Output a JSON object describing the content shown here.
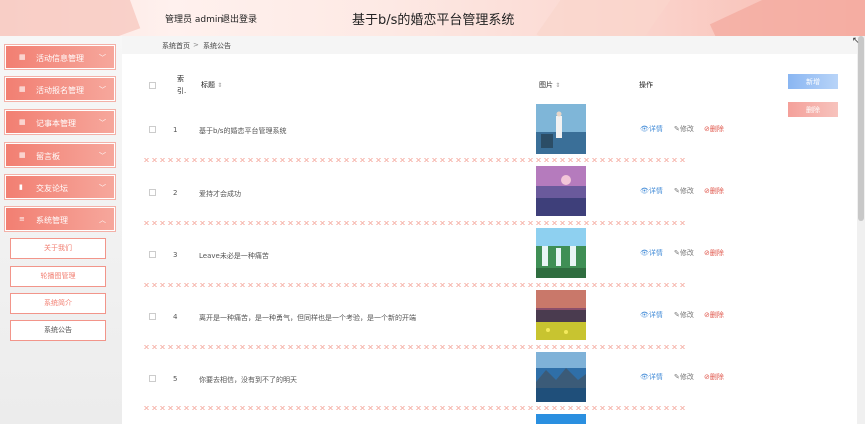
{
  "header": {
    "admin_text": "管理员 admin",
    "logout": "退出登录",
    "title": "基于b/s的婚恋平台管理系统"
  },
  "sidebar": {
    "menus": [
      {
        "label": "活动信息管理",
        "icon": "grid-icon"
      },
      {
        "label": "活动报名管理",
        "icon": "grid-icon"
      },
      {
        "label": "记事本管理",
        "icon": "grid-icon"
      },
      {
        "label": "留言板",
        "icon": "grid-icon"
      },
      {
        "label": "交友论坛",
        "icon": "bar-chart-icon"
      },
      {
        "label": "系统管理",
        "icon": "list-icon"
      }
    ],
    "submenu": [
      {
        "label": "关于我们"
      },
      {
        "label": "轮播图管理"
      },
      {
        "label": "系统简介"
      },
      {
        "label": "系统公告"
      }
    ]
  },
  "breadcrumb": {
    "home": "系统首页",
    "separator": ">",
    "current": "系统公告"
  },
  "table": {
    "headers": {
      "index_line1": "索",
      "index_line2": "引.",
      "title": "标题",
      "image": "图片",
      "actions": "操作"
    },
    "rows": [
      {
        "index": "1",
        "title": "基于b/s的婚恋平台管理系统"
      },
      {
        "index": "2",
        "title": "爱持才会成功"
      },
      {
        "index": "3",
        "title": "Leave未必是一种痛苦"
      },
      {
        "index": "4",
        "title": "离开是一种痛苦，是一种勇气，但同样也是一个考验，是一个新的开端"
      },
      {
        "index": "5",
        "title": "你要去相信，没有到不了的明天"
      }
    ],
    "actions": {
      "view": "详情",
      "edit": "修改",
      "delete": "删除"
    }
  },
  "buttons": {
    "add": "新增",
    "delete": "删除"
  },
  "colors": {
    "menu_primary": "#f27f72",
    "add_button": "#8ab6f2",
    "delete_button": "#f4a09a"
  }
}
